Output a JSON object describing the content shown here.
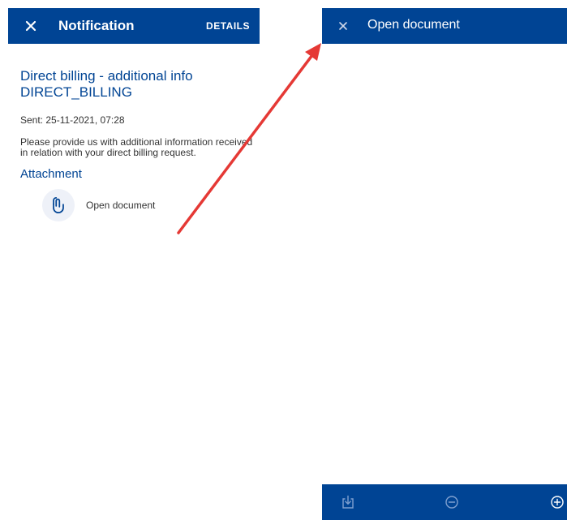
{
  "notification": {
    "header": {
      "title": "Notification",
      "details_label": "DETAILS"
    },
    "title_line1": "Direct billing - additional info",
    "title_line2": "DIRECT_BILLING",
    "sent": "Sent: 25-11-2021, 07:28",
    "message": "Please provide us with additional information received in relation with your direct billing request.",
    "attachment_heading": "Attachment",
    "attachment": {
      "label": "Open document",
      "icon": "paperclip-icon"
    }
  },
  "viewer": {
    "header": {
      "title": "Open document"
    },
    "toolbar": {
      "download_icon": "download-icon",
      "zoom_out_icon": "zoom-out-icon",
      "zoom_in_icon": "zoom-in-icon"
    }
  },
  "colors": {
    "header_bg": "#004494",
    "title_text": "#004494",
    "body_text": "#333333",
    "attachment_circle": "#eef1f8",
    "arrow": "#e53935"
  }
}
